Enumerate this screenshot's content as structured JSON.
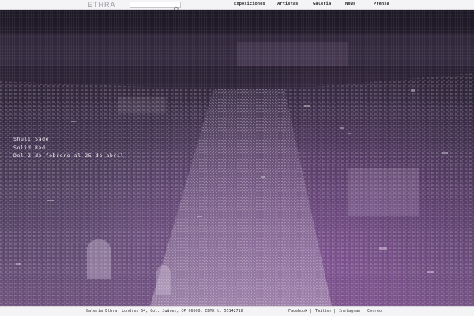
{
  "header": {
    "logo_text": "ETHRA",
    "search": {
      "value": "",
      "placeholder": "",
      "icon": "search-icon"
    },
    "nav": [
      {
        "label": "Exposiciones"
      },
      {
        "label": "Artistas"
      },
      {
        "label": "Galeria"
      },
      {
        "label": "News"
      },
      {
        "label": "Prensa"
      }
    ]
  },
  "hero": {
    "background_colors": [
      "#1c1724",
      "#3c2f49",
      "#6a4f78"
    ],
    "caption": {
      "artist": "Shuli Sade",
      "title": "Solid Red",
      "dates": "Del 2 de febrero al 25 de abril"
    }
  },
  "footer": {
    "address": "Galería Ethra, Londres 54, Col. Juárez, CP 06600, CDMX t. 55142710",
    "separator": "•",
    "links": [
      {
        "label": "Facebook"
      },
      {
        "label": "Twitter"
      },
      {
        "label": "Instagram"
      },
      {
        "label": "Correo"
      }
    ],
    "pipe": "|"
  },
  "colors": {
    "bar_bg": "#f4f3f5",
    "text_dark": "#333333",
    "caption_text": "#f2eff5",
    "accent_purple": "#6a4f78"
  }
}
